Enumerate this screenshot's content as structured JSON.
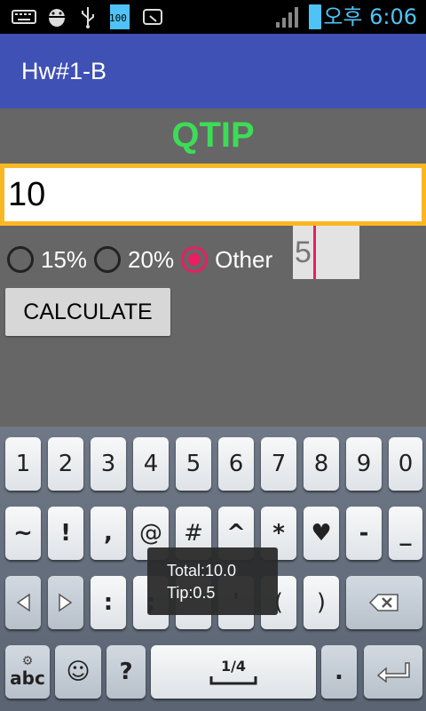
{
  "status_bar": {
    "icons": [
      "keyboard-icon",
      "android-debug-icon",
      "usb-icon",
      "battery-100-icon",
      "screen-mirror-icon",
      "signal-icon",
      "battery-icon"
    ],
    "battery_label": "100",
    "time": "오후 6:06"
  },
  "app": {
    "title": "Hw#1-B"
  },
  "main": {
    "heading": "QTIP",
    "bill_amount": "10",
    "tip_options": [
      {
        "label": "15%",
        "checked": false
      },
      {
        "label": "20%",
        "checked": false
      },
      {
        "label": "Other",
        "checked": true
      }
    ],
    "other_value": "5",
    "calculate_label": "CALCULATE"
  },
  "toast": {
    "line1": "Total:10.0",
    "line2": "Tip:0.5"
  },
  "keyboard": {
    "row1": [
      "1",
      "2",
      "3",
      "4",
      "5",
      "6",
      "7",
      "8",
      "9",
      "0"
    ],
    "row2": [
      "~",
      "!",
      ",",
      "@",
      "#",
      "^",
      "*",
      "♥",
      "-",
      "_"
    ],
    "row3": [
      ":",
      ";",
      "\"",
      "'",
      "(",
      ")"
    ],
    "page_indicator": "1/4",
    "abc_label": "abc",
    "question_label": "?",
    "period_label": "."
  },
  "colors": {
    "action_bar": "#3f51b5",
    "heading": "#3ddc57",
    "input_border": "#f9b823",
    "accent": "#e91e63"
  }
}
